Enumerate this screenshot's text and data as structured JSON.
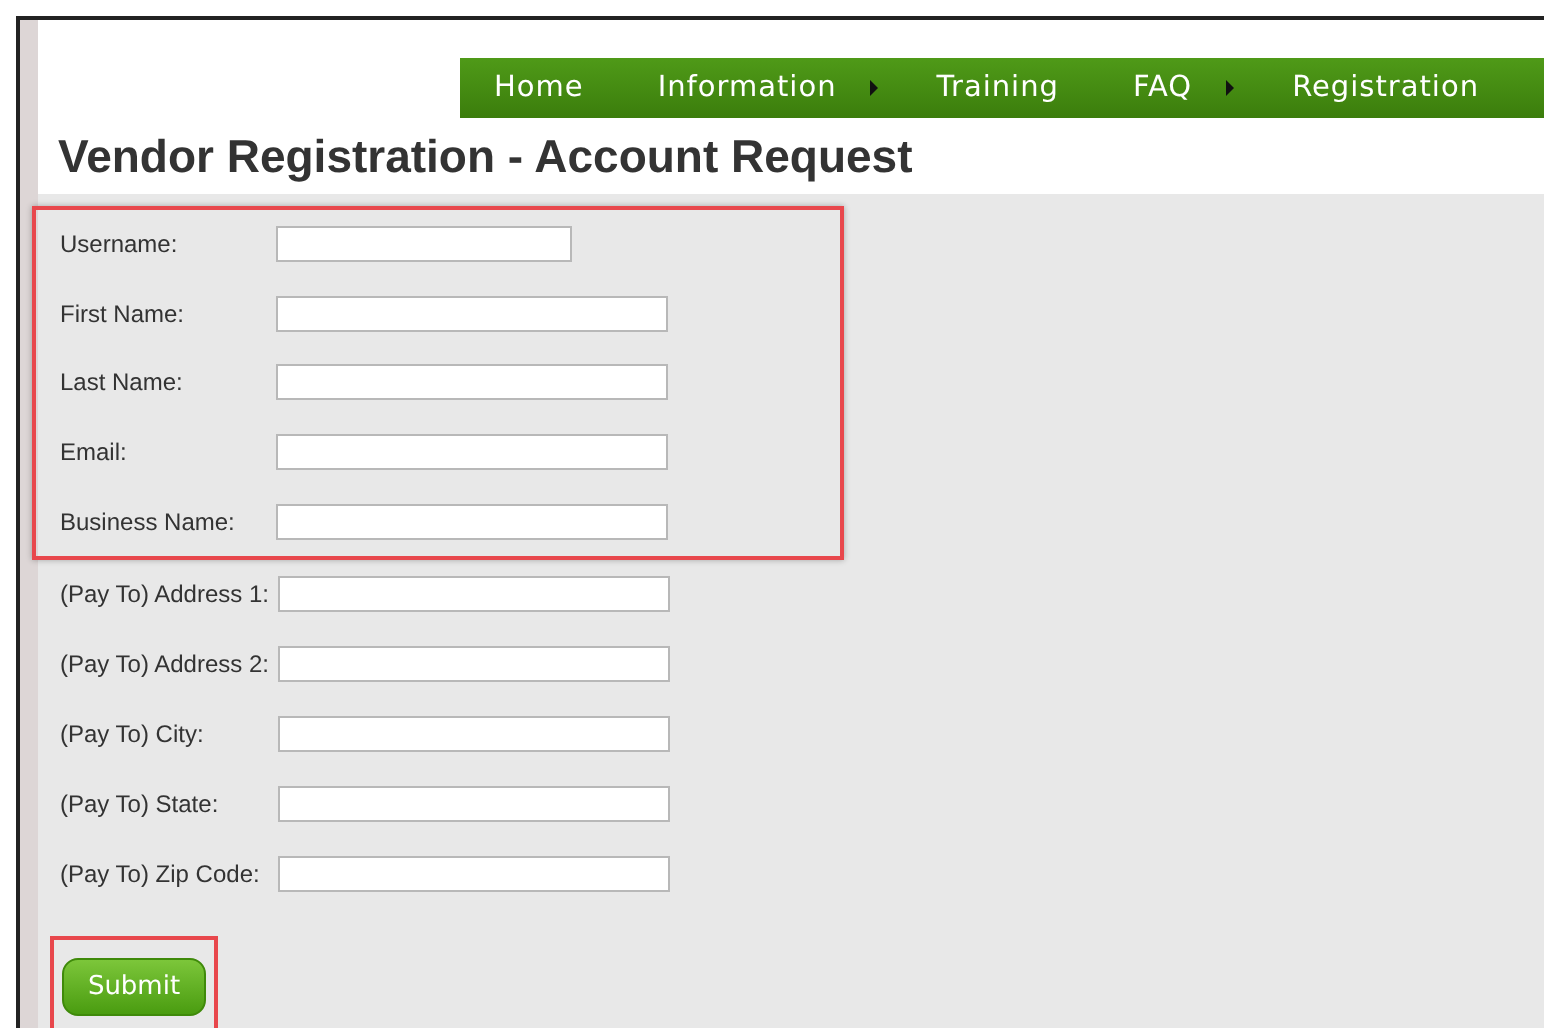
{
  "nav": [
    {
      "label": "Home",
      "has_submenu": false
    },
    {
      "label": "Information",
      "has_submenu": true
    },
    {
      "label": "Training",
      "has_submenu": false
    },
    {
      "label": "FAQ",
      "has_submenu": true
    },
    {
      "label": "Registration",
      "has_submenu": false
    }
  ],
  "title": "Vendor Registration - Account Request",
  "form": {
    "groups": [
      {
        "highlighted": true,
        "fields": [
          {
            "label": "Username:",
            "kind": "short"
          },
          {
            "label": "First Name:",
            "kind": "long"
          },
          {
            "label": "Last Name:",
            "kind": "long"
          },
          {
            "label": "Email:",
            "kind": "long"
          },
          {
            "label": "Business Name:",
            "kind": "long"
          }
        ]
      },
      {
        "highlighted": false,
        "fields": [
          {
            "label": "(Pay To) Address 1:",
            "kind": "long"
          },
          {
            "label": "(Pay To) Address 2:",
            "kind": "long"
          },
          {
            "label": "(Pay To) City:",
            "kind": "long"
          },
          {
            "label": "(Pay To) State:",
            "kind": "long"
          },
          {
            "label": "(Pay To) Zip Code:",
            "kind": "long"
          }
        ]
      }
    ],
    "submit": {
      "label": "Submit",
      "highlighted": true
    }
  }
}
